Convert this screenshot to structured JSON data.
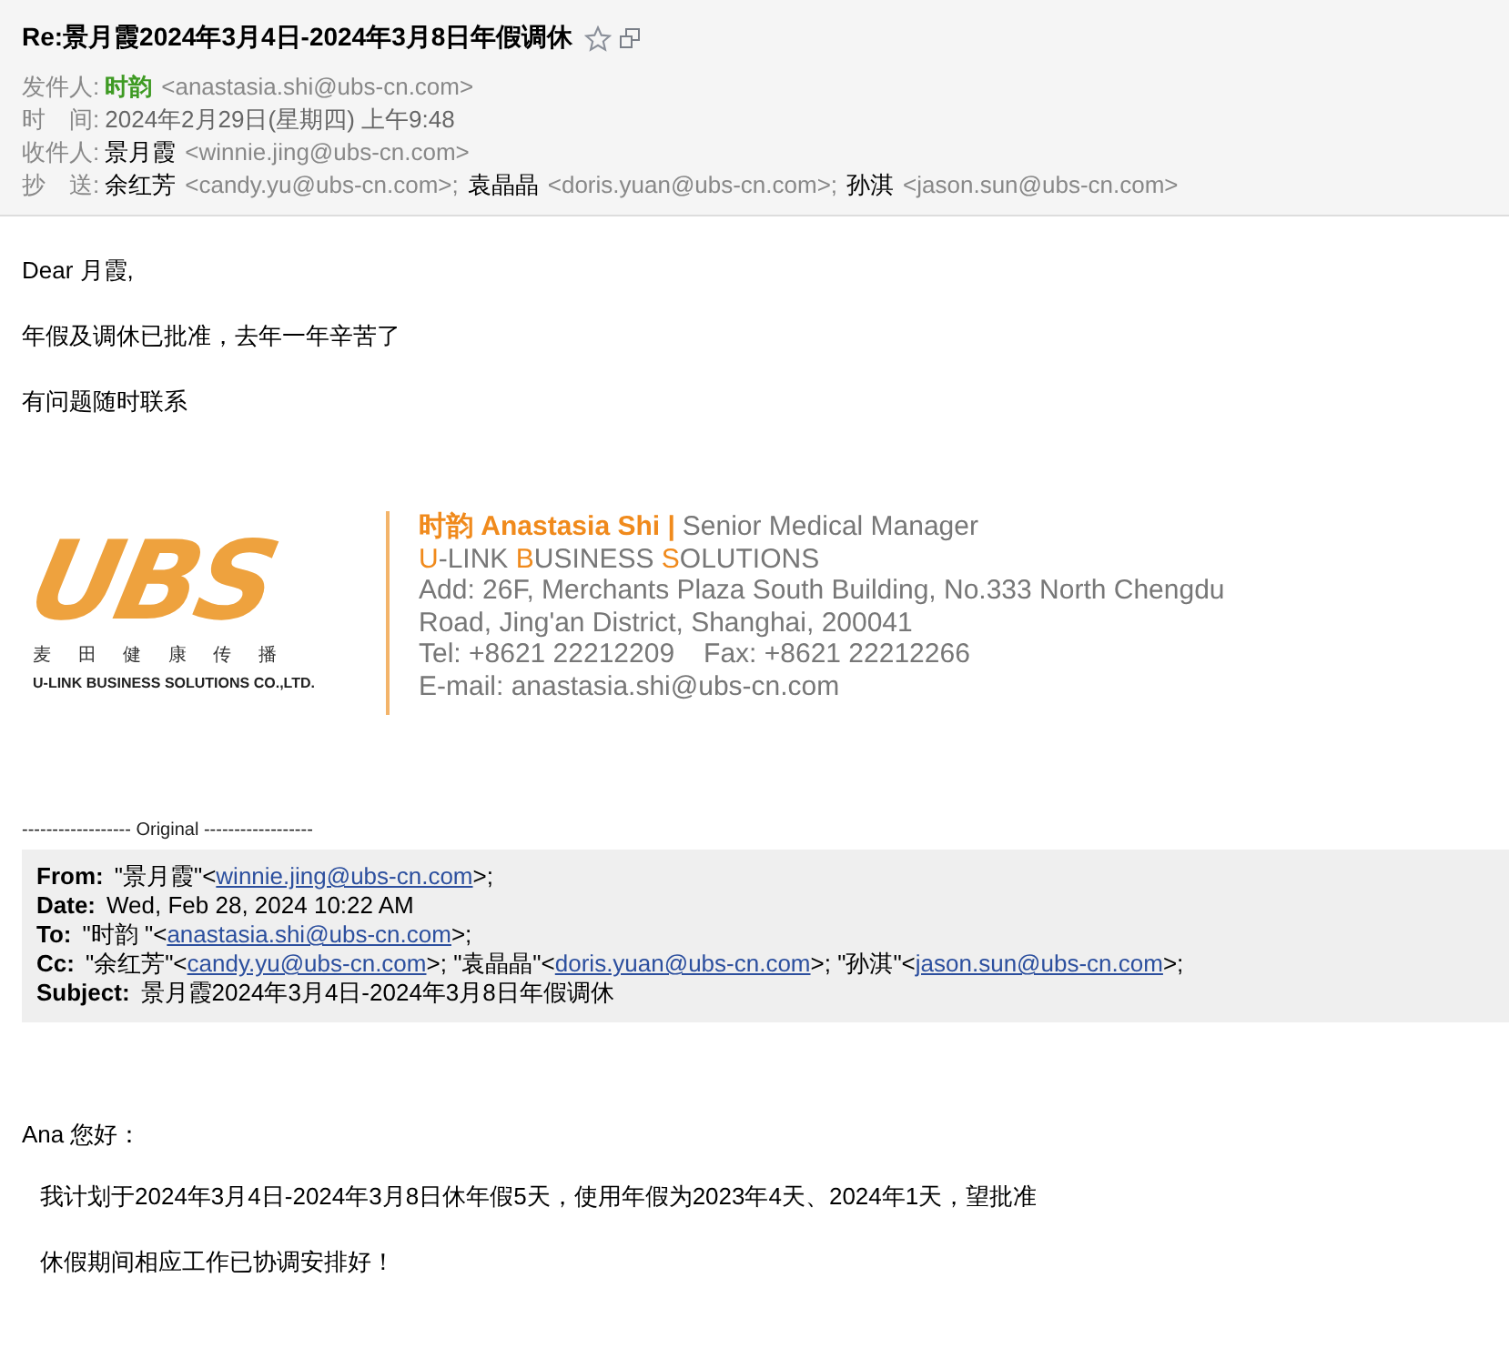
{
  "header": {
    "subject": "Re:景月霞2024年3月4日-2024年3月8日年假调休",
    "from": {
      "label": "发件人:",
      "name": "时韵",
      "email": "<anastasia.shi@ubs-cn.com>"
    },
    "time": {
      "label": "时　间:",
      "value": "2024年2月29日(星期四) 上午9:48"
    },
    "to": {
      "label": "收件人:",
      "recipients": [
        {
          "name": "景月霞",
          "email": "<winnie.jing@ubs-cn.com>"
        }
      ]
    },
    "cc": {
      "label": "抄　送:",
      "recipients": [
        {
          "name": "余红芳",
          "email": "<candy.yu@ubs-cn.com>;"
        },
        {
          "name": "袁晶晶",
          "email": "<doris.yuan@ubs-cn.com>;"
        },
        {
          "name": "孙淇",
          "email": "<jason.sun@ubs-cn.com>"
        }
      ]
    }
  },
  "body": [
    "Dear 月霞,",
    "年假及调休已批准，去年一年辛苦了",
    "有问题随时联系"
  ],
  "signature": {
    "logo": {
      "letters": "UBS",
      "chinese": "麦 田 健 康 传 播",
      "english": "U-LINK BUSINESS SOLUTIONS CO.,LTD."
    },
    "name": "时韵 Anastasia Shi |",
    "title": "Senior Medical Manager",
    "company": [
      {
        "text": "U",
        "accent": true
      },
      {
        "text": "-LINK ",
        "accent": false
      },
      {
        "text": "B",
        "accent": true
      },
      {
        "text": "USINESS ",
        "accent": false
      },
      {
        "text": "S",
        "accent": true
      },
      {
        "text": "OLUTIONS",
        "accent": false
      }
    ],
    "address": [
      "Add: 26F, Merchants Plaza South Building, No.333 North Chengdu",
      "Road, Jing'an District, Shanghai, 200041"
    ],
    "tel": "Tel: +8621 22212209",
    "fax": "Fax: +8621 22212266",
    "email": "E-mail: anastasia.shi@ubs-cn.com"
  },
  "original_divider": "------------------ Original ------------------",
  "quoted": {
    "rows": [
      {
        "label": "From:",
        "parts": [
          {
            "text": "\"景月霞\"<",
            "link": false
          },
          {
            "text": "winnie.jing@ubs-cn.com",
            "link": true
          },
          {
            "text": ">;",
            "link": false
          }
        ]
      },
      {
        "label": "Date:",
        "parts": [
          {
            "text": "Wed, Feb 28, 2024 10:22 AM",
            "link": false
          }
        ]
      },
      {
        "label": "To:",
        "parts": [
          {
            "text": "\"时韵 \"<",
            "link": false
          },
          {
            "text": "anastasia.shi@ubs-cn.com",
            "link": true
          },
          {
            "text": ">;",
            "link": false
          }
        ]
      },
      {
        "label": "Cc:",
        "parts": [
          {
            "text": "\"余红芳\"<",
            "link": false
          },
          {
            "text": "candy.yu@ubs-cn.com",
            "link": true
          },
          {
            "text": ">; \"袁晶晶\"<",
            "link": false
          },
          {
            "text": "doris.yuan@ubs-cn.com",
            "link": true
          },
          {
            "text": ">; \"孙淇\"<",
            "link": false
          },
          {
            "text": "jason.sun@ubs-cn.com",
            "link": true
          },
          {
            "text": ">;",
            "link": false
          }
        ]
      },
      {
        "label": "Subject:",
        "parts": [
          {
            "text": "景月霞2024年3月4日-2024年3月8日年假调休",
            "link": false
          }
        ]
      }
    ]
  },
  "reply": {
    "greeting": "Ana 您好：",
    "lines": [
      "我计划于2024年3月4日-2024年3月8日休年假5天，使用年假为2023年4天、2024年1天，望批准",
      "休假期间相应工作已协调安排好！"
    ]
  }
}
